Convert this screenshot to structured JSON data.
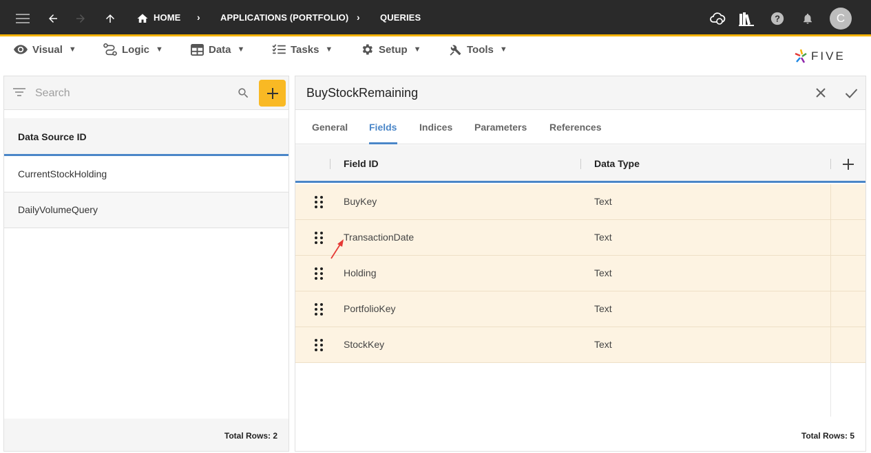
{
  "topbar": {
    "breadcrumbs": [
      "HOME",
      "APPLICATIONS (PORTFOLIO)",
      "QUERIES"
    ],
    "avatar_initial": "C",
    "accent_color": "#f5b301"
  },
  "menu": {
    "items": [
      {
        "label": "Visual",
        "icon": "eye-icon"
      },
      {
        "label": "Logic",
        "icon": "logic-icon"
      },
      {
        "label": "Data",
        "icon": "table-icon"
      },
      {
        "label": "Tasks",
        "icon": "tasks-icon"
      },
      {
        "label": "Setup",
        "icon": "gear-icon"
      },
      {
        "label": "Tools",
        "icon": "tools-icon"
      }
    ],
    "caret": "▼",
    "logo_text": "FIVE"
  },
  "left": {
    "search_placeholder": "Search",
    "column_header": "Data Source ID",
    "rows": [
      "CurrentStockHolding",
      "DailyVolumeQuery"
    ],
    "footer": "Total Rows: 2"
  },
  "form": {
    "title": "BuyStockRemaining",
    "tabs": [
      "General",
      "Fields",
      "Indices",
      "Parameters",
      "References"
    ],
    "active_tab": "Fields",
    "columns": [
      "Field ID",
      "Data Type"
    ],
    "rows": [
      {
        "field": "BuyKey",
        "type": "Text"
      },
      {
        "field": "TransactionDate",
        "type": "Text"
      },
      {
        "field": "Holding",
        "type": "Text"
      },
      {
        "field": "PortfolioKey",
        "type": "Text"
      },
      {
        "field": "StockKey",
        "type": "Text"
      }
    ],
    "footer": "Total Rows: 5"
  },
  "colors": {
    "accent_blue": "#4a86c8",
    "add_button": "#f9b924",
    "row_highlight": "#fdf3e2",
    "annotation": "#e53935"
  }
}
